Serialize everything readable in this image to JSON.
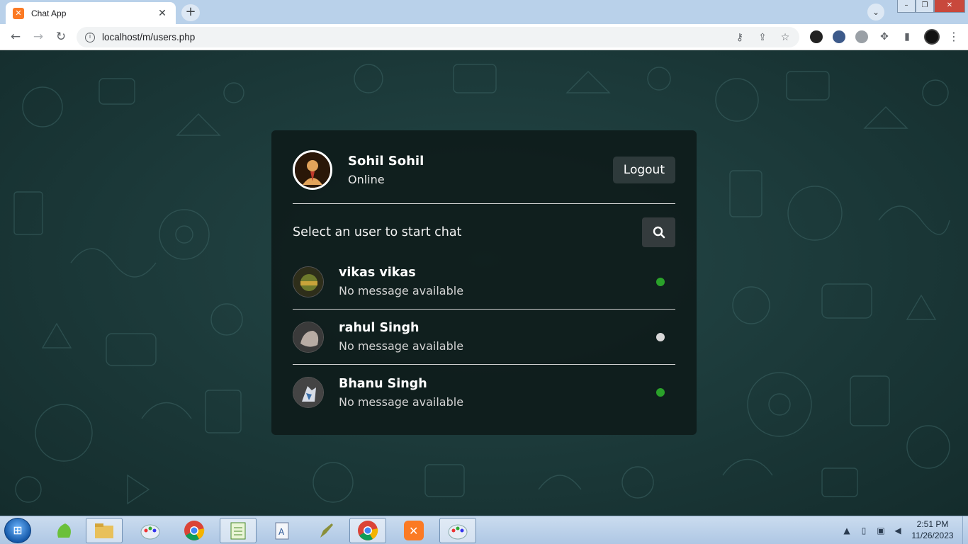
{
  "browser": {
    "tab_title": "Chat App",
    "tab_favicon": "xampp-icon",
    "url": "localhost/m/users.php"
  },
  "card": {
    "current_user": {
      "name": "Sohil Sohil",
      "status": "Online"
    },
    "logout_label": "Logout",
    "search_prompt": "Select an user to start chat",
    "users": [
      {
        "name": "vikas vikas",
        "message": "No message available",
        "status": "online",
        "status_color": "#2aa12a"
      },
      {
        "name": "rahul Singh",
        "message": "No message available",
        "status": "offline",
        "status_color": "#d8d8d8"
      },
      {
        "name": "Bhanu Singh",
        "message": "No message available",
        "status": "online",
        "status_color": "#2aa12a"
      }
    ]
  },
  "taskbar": {
    "time": "2:51 PM",
    "date": "11/26/2023"
  }
}
